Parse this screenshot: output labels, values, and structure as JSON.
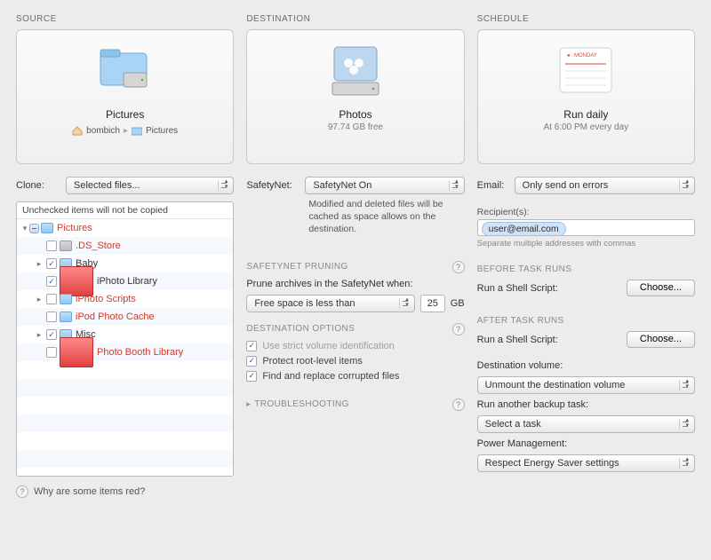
{
  "headers": {
    "source": "SOURCE",
    "destination": "DESTINATION",
    "schedule": "SCHEDULE"
  },
  "source": {
    "card_title": "Pictures",
    "breadcrumb": {
      "root": "bombich",
      "leaf": "Pictures"
    },
    "clone_label": "Clone:",
    "clone_value": "Selected files...",
    "tree_header": "Unchecked items will not be copied",
    "items": [
      {
        "label": "Pictures",
        "red": true,
        "checked": "minus",
        "disc": "d",
        "icon": "folder"
      },
      {
        "label": ".DS_Store",
        "red": true,
        "checked": false,
        "disc": "",
        "icon": "gray",
        "indent": 1
      },
      {
        "label": "Baby",
        "red": false,
        "checked": true,
        "disc": "r",
        "icon": "folder",
        "indent": 1
      },
      {
        "label": "iPhoto Library",
        "red": false,
        "checked": true,
        "disc": "",
        "icon": "app",
        "indent": 1
      },
      {
        "label": "iPhoto Scripts",
        "red": true,
        "checked": false,
        "disc": "r",
        "icon": "folder",
        "indent": 1
      },
      {
        "label": "iPod Photo Cache",
        "red": true,
        "checked": false,
        "disc": "",
        "icon": "folder",
        "indent": 1
      },
      {
        "label": "Misc",
        "red": false,
        "checked": true,
        "disc": "r",
        "icon": "folder",
        "indent": 1
      },
      {
        "label": "Photo Booth Library",
        "red": true,
        "checked": false,
        "disc": "",
        "icon": "app",
        "indent": 1
      }
    ],
    "help_text": "Why are some items red?"
  },
  "destination": {
    "card_title": "Photos",
    "card_sub": "97.74 GB free",
    "safetynet_label": "SafetyNet:",
    "safetynet_value": "SafetyNet On",
    "safetynet_desc": "Modified and deleted files will be cached as space allows on the destination.",
    "pruning_head": "SAFETYNET PRUNING",
    "pruning_label": "Prune archives in the SafetyNet when:",
    "pruning_value": "Free space is less than",
    "pruning_number": "25",
    "pruning_unit": "GB",
    "options_head": "DESTINATION OPTIONS",
    "opt1": "Use strict volume identification",
    "opt2": "Protect root-level items",
    "opt3": "Find and replace corrupted files",
    "troubleshooting": "TROUBLESHOOTING"
  },
  "schedule": {
    "card_title": "Run daily",
    "card_sub": "At 6:00 PM every day",
    "calendar_label": "MONDAY",
    "email_label": "Email:",
    "email_value": "Only send on errors",
    "recipients_label": "Recipient(s):",
    "recipient": "user@email.com",
    "recipients_hint": "Separate multiple addresses with commas",
    "before_head": "BEFORE TASK RUNS",
    "after_head": "AFTER TASK RUNS",
    "shell_label": "Run a Shell Script:",
    "choose_btn": "Choose...",
    "dest_vol_label": "Destination volume:",
    "dest_vol_value": "Unmount the destination volume",
    "another_label": "Run another backup task:",
    "another_value": "Select a task",
    "power_label": "Power Management:",
    "power_value": "Respect Energy Saver settings"
  }
}
